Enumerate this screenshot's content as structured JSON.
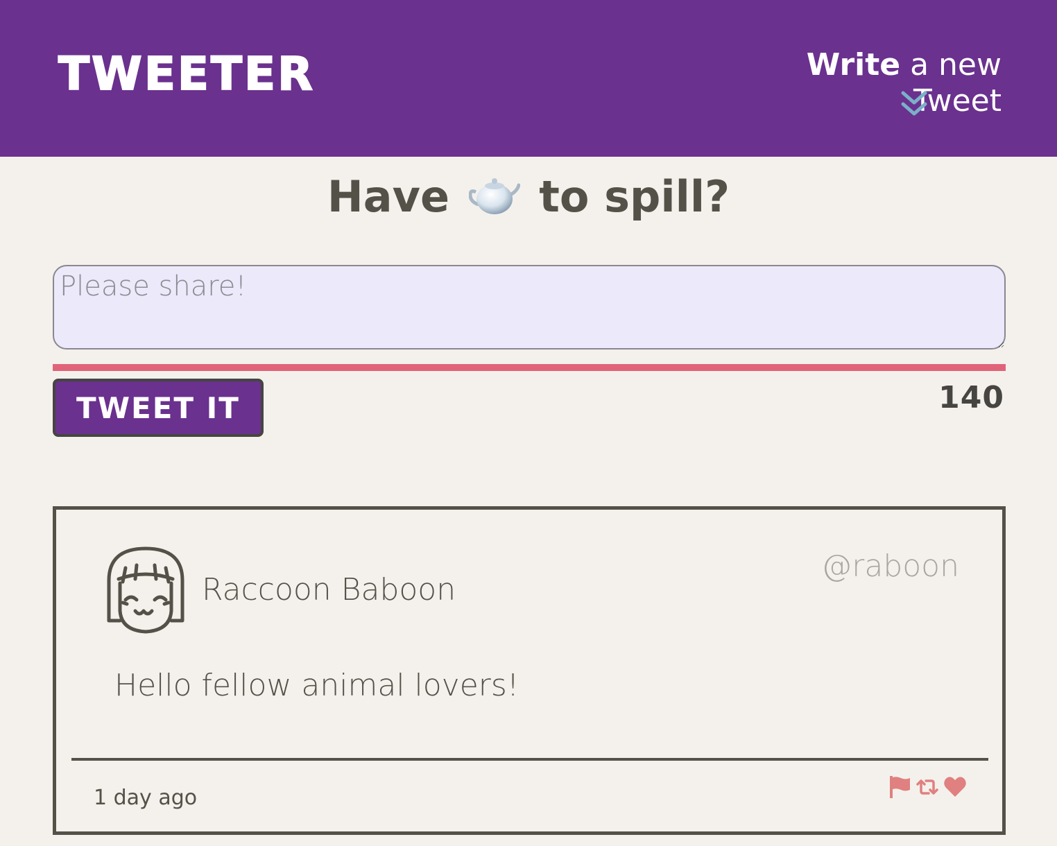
{
  "colors": {
    "brand": "#6a318e",
    "accent_chevron": "#7bb0c9",
    "counter_bar": "#e0637a",
    "action_icons": "#e08080"
  },
  "header": {
    "brand": "Tweeter",
    "compose_bold": "Write",
    "compose_rest": " a new Tweet",
    "compose_icon": "double-chevron-down-icon"
  },
  "composer": {
    "title_before": "Have",
    "title_emoji": "teapot-icon",
    "title_after": "to spill?",
    "placeholder": "Please share!",
    "value": "",
    "button_label": "Tweet It",
    "char_count": "140"
  },
  "tweets": [
    {
      "author_name": "Raccoon Baboon",
      "handle": "@raboon",
      "avatar": "girl-face-avatar-icon",
      "text": "Hello fellow animal lovers!",
      "timestamp": "1 day ago",
      "actions": [
        "flag-icon",
        "retweet-icon",
        "heart-icon"
      ]
    }
  ]
}
